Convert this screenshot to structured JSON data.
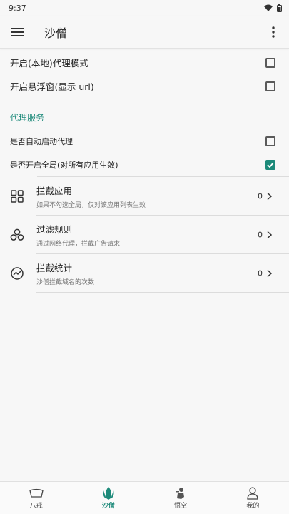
{
  "status_bar": {
    "time": "9:37"
  },
  "app_bar": {
    "title": "沙僧"
  },
  "options_top": [
    {
      "label": "开启(本地)代理模式",
      "checked": false
    },
    {
      "label": "开启悬浮窗(显示 url)",
      "checked": false
    }
  ],
  "proxy_section": {
    "title": "代理服务",
    "options": [
      {
        "label": "是否自动启动代理",
        "checked": false
      },
      {
        "label": "是否开启全局(对所有应用生效)",
        "checked": true
      }
    ]
  },
  "nav_items": [
    {
      "title": "拦截应用",
      "subtitle": "如果不勾选全局，仅对该应用列表生效",
      "count": "0",
      "icon": "grid-icon"
    },
    {
      "title": "过滤规则",
      "subtitle": "通过网络代理，拦截广告请求",
      "count": "0",
      "icon": "hexagons-icon"
    },
    {
      "title": "拦截统计",
      "subtitle": "沙僧拦截域名的次数",
      "count": "0",
      "icon": "chart-circle-icon"
    }
  ],
  "bottom_nav": [
    {
      "label": "八戒",
      "icon": "pig-icon",
      "active": false
    },
    {
      "label": "沙僧",
      "icon": "leaf-icon",
      "active": true
    },
    {
      "label": "悟空",
      "icon": "monkey-icon",
      "active": false
    },
    {
      "label": "我的",
      "icon": "person-icon",
      "active": false
    }
  ],
  "colors": {
    "accent": "#1d8a7a",
    "background": "#f7f7f7"
  }
}
